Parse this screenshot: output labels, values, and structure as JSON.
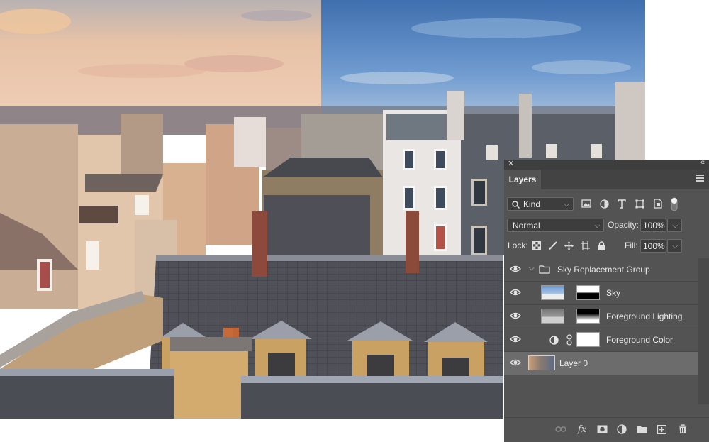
{
  "panel": {
    "close_glyph": "✕",
    "collapse_glyph": "«",
    "tab_label": "Layers",
    "filter": {
      "value": "Kind",
      "icon": "search-icon"
    },
    "blend_mode": "Normal",
    "opacity_label": "Opacity:",
    "opacity_value": "100%",
    "lock_label": "Lock:",
    "fill_label": "Fill:",
    "fill_value": "100%",
    "layers": [
      {
        "name": "Sky Replacement Group",
        "type": "group",
        "expanded": true,
        "visible": true
      },
      {
        "name": "Sky",
        "type": "pixel-with-mask",
        "visible": true
      },
      {
        "name": "Foreground Lighting",
        "type": "pixel-with-mask",
        "visible": true
      },
      {
        "name": "Foreground Color",
        "type": "adjustment",
        "visible": true
      },
      {
        "name": "Layer 0",
        "type": "pixel",
        "visible": true,
        "selected": true
      }
    ],
    "bottom_icons": [
      "link-layers-icon",
      "fx-icon",
      "add-mask-icon",
      "adjustment-layer-icon",
      "new-group-icon",
      "new-layer-icon",
      "delete-icon"
    ],
    "fx_glyph": "fx"
  },
  "colors": {
    "panel_bg": "#535353",
    "selected_row": "#6c6c6c",
    "sky_warm": "#e9c3a4",
    "sky_blue": "#5d8fc9"
  }
}
